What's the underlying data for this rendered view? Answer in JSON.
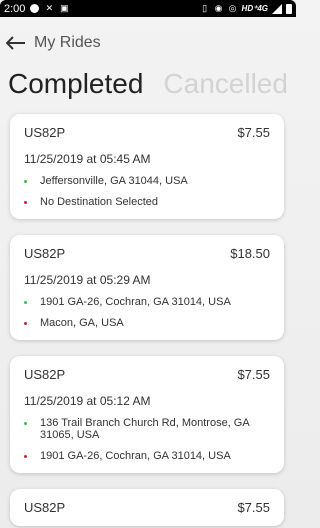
{
  "status_bar": {
    "time": "2:00",
    "network": "HD⁺4G"
  },
  "header": {
    "title": "My Rides"
  },
  "tabs": {
    "completed": "Completed",
    "cancelled": "Cancelled"
  },
  "rides": [
    {
      "vehicle": "US82P",
      "price": "$7.55",
      "datetime": "11/25/2019 at 05:45 AM",
      "pickup": "Jeffersonville, GA 31044, USA",
      "dropoff": "No Destination Selected"
    },
    {
      "vehicle": "US82P",
      "price": "$18.50",
      "datetime": "11/25/2019 at 05:29 AM",
      "pickup": "1901 GA-26, Cochran, GA 31014, USA",
      "dropoff": "Macon, GA, USA"
    },
    {
      "vehicle": "US82P",
      "price": "$7.55",
      "datetime": "11/25/2019 at 05:12 AM",
      "pickup": "136 Trail Branch Church Rd, Montrose, GA 31065, USA",
      "dropoff": "1901 GA-26, Cochran, GA 31014, USA"
    },
    {
      "vehicle": "US82P",
      "price": "$7.55"
    }
  ],
  "colors": {
    "pickup_dot": "#39c24a",
    "dropoff_dot": "#c0283a",
    "inactive_tab": "#d3d3d3"
  }
}
